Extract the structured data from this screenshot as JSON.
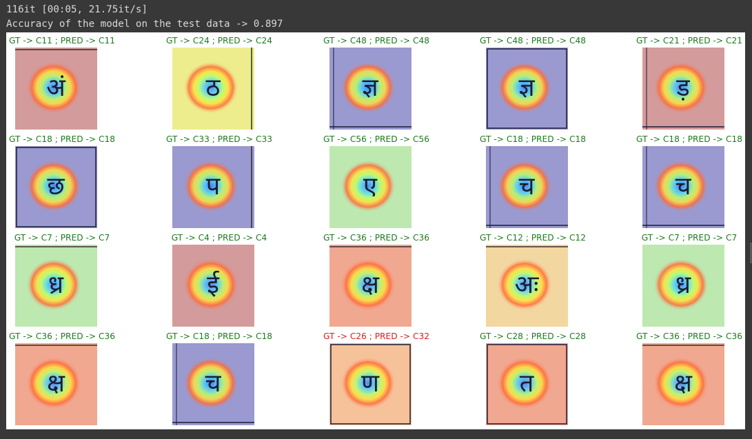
{
  "stdout": {
    "line1": "116it [00:05, 21.75it/s]",
    "line2": "Accuracy of the model on the test data -> 0.897"
  },
  "colors": {
    "correct": "#1c7a1c",
    "incorrect": "#e01b1b",
    "background": "#383838",
    "stdout_text": "#d8d8d8"
  },
  "grid": [
    [
      {
        "caption": "GT -> C11 ; PRED -> C11",
        "correct": true,
        "bg": "#d39b9b",
        "glyph": "अं",
        "frame": "top"
      },
      {
        "caption": "GT -> C24 ; PRED -> C24",
        "correct": true,
        "bg": "#eded8e",
        "glyph": "ठ",
        "frame": "right"
      },
      {
        "caption": "GT -> C48 ; PRED -> C48",
        "correct": true,
        "bg": "#9a9ad0",
        "glyph": "ज्ञ",
        "frame": "bottom"
      },
      {
        "caption": "GT -> C48 ; PRED -> C48",
        "correct": true,
        "bg": "#9a9ad0",
        "glyph": "ज्ञ",
        "frame": "box"
      },
      {
        "caption": "GT -> C21 ; PRED -> C21",
        "correct": true,
        "bg": "#d39b9b",
        "glyph": "ड़",
        "frame": "bottom"
      }
    ],
    [
      {
        "caption": "GT -> C18 ; PRED -> C18",
        "correct": true,
        "bg": "#9a9ad0",
        "glyph": "छ",
        "frame": "box"
      },
      {
        "caption": "GT -> C33 ; PRED -> C33",
        "correct": true,
        "bg": "#9a9ad0",
        "glyph": "प",
        "frame": "right"
      },
      {
        "caption": "GT -> C56 ; PRED -> C56",
        "correct": true,
        "bg": "#bde8b0",
        "glyph": "ए",
        "frame": "none"
      },
      {
        "caption": "GT -> C18 ; PRED -> C18",
        "correct": true,
        "bg": "#9a9ad0",
        "glyph": "च",
        "frame": "bottom"
      },
      {
        "caption": "GT -> C18 ; PRED -> C18",
        "correct": true,
        "bg": "#9a9ad0",
        "glyph": "च",
        "frame": "bottom"
      }
    ],
    [
      {
        "caption": "GT -> C7 ; PRED -> C7",
        "correct": true,
        "bg": "#bde8b0",
        "glyph": "ध्र",
        "frame": "top"
      },
      {
        "caption": "GT -> C4 ; PRED -> C4",
        "correct": true,
        "bg": "#d39b9b",
        "glyph": "ई",
        "frame": "none"
      },
      {
        "caption": "GT -> C36 ; PRED -> C36",
        "correct": true,
        "bg": "#f0a890",
        "glyph": "क्ष",
        "frame": "top"
      },
      {
        "caption": "GT -> C12 ; PRED -> C12",
        "correct": true,
        "bg": "#f2d7a0",
        "glyph": "अः",
        "frame": "top"
      },
      {
        "caption": "GT -> C7 ; PRED -> C7",
        "correct": true,
        "bg": "#bde8b0",
        "glyph": "ध्र",
        "frame": "none"
      }
    ],
    [
      {
        "caption": "GT -> C36 ; PRED -> C36",
        "correct": true,
        "bg": "#f0a890",
        "glyph": "क्ष",
        "frame": "top"
      },
      {
        "caption": "GT -> C18 ; PRED -> C18",
        "correct": true,
        "bg": "#9a9ad0",
        "glyph": "च",
        "frame": "bottom"
      },
      {
        "caption": "GT -> C26 ; PRED -> C32",
        "correct": false,
        "bg": "#f5c29a",
        "glyph": "ण",
        "frame": "box"
      },
      {
        "caption": "GT -> C28 ; PRED -> C28",
        "correct": true,
        "bg": "#f0a890",
        "glyph": "त",
        "frame": "box"
      },
      {
        "caption": "GT -> C36 ; PRED -> C36",
        "correct": true,
        "bg": "#f0a890",
        "glyph": "क्ष",
        "frame": "top"
      }
    ]
  ]
}
